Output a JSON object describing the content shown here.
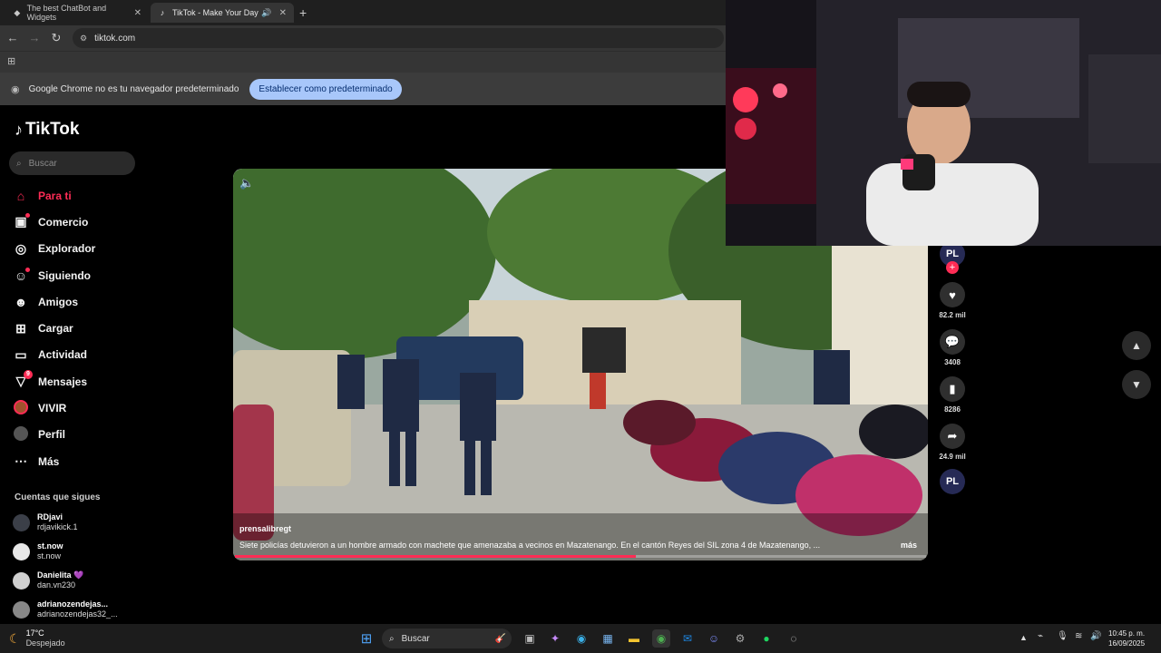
{
  "browser": {
    "tabs": [
      {
        "title": "The best ChatBot and Widgets",
        "icon": "chatbot-favicon-icon"
      },
      {
        "title": "TikTok - Make Your Day",
        "icon": "tiktok-favicon-icon"
      }
    ],
    "url": "tiktok.com",
    "infobar": {
      "message": "Google Chrome no es tu navegador predeterminado",
      "button": "Establecer como predeterminado"
    }
  },
  "tiktok": {
    "logo": "TikTok",
    "search_placeholder": "Buscar",
    "nav": [
      {
        "label": "Para ti",
        "icon": "home-icon",
        "glyph": "⌂"
      },
      {
        "label": "Comercio",
        "icon": "shop-icon",
        "glyph": "🛍"
      },
      {
        "label": "Explorador",
        "icon": "compass-icon",
        "glyph": "◎"
      },
      {
        "label": "Siguiendo",
        "icon": "following-icon",
        "glyph": "👤"
      },
      {
        "label": "Amigos",
        "icon": "friends-icon",
        "glyph": "👥"
      },
      {
        "label": "Cargar",
        "icon": "upload-icon",
        "glyph": "⊞"
      },
      {
        "label": "Actividad",
        "icon": "activity-icon",
        "glyph": "▭"
      },
      {
        "label": "Mensajes",
        "icon": "messages-icon",
        "glyph": "▽",
        "badge": "9"
      },
      {
        "label": "VIVIR",
        "icon": "live-icon",
        "glyph": "●"
      },
      {
        "label": "Perfil",
        "icon": "profile-icon",
        "glyph": "●"
      },
      {
        "label": "Más",
        "icon": "more-icon",
        "glyph": "⋯"
      }
    ],
    "following_title": "Cuentas que sigues",
    "following": [
      {
        "name": "RDjavi",
        "user": "rdjavikick.1"
      },
      {
        "name": "st.now",
        "user": "st.now"
      },
      {
        "name": "Danielita 💜",
        "user": "dan.vn230"
      },
      {
        "name": "adrianozendejas...",
        "user": "adrianozendejas32_..."
      }
    ],
    "video": {
      "author": "prensalibregt",
      "caption": "Siete policías detuvieron a un hombre armado con machete que amenazaba a vecinos en Mazatenango. En el cantón Reyes del SIL zona 4 de Mazatenango, ...",
      "more": "más",
      "progress": 0.58
    },
    "actions": {
      "avatar": "PL",
      "likes": "82.2 mil",
      "comments": "3408",
      "saves": "8286",
      "shares": "24.9 mil"
    }
  },
  "taskbar": {
    "temp": "17°C",
    "condition": "Despejado",
    "search": "Buscar",
    "time": "10:45 p. m.",
    "date": "16/09/2025"
  },
  "colors": {
    "accent": "#fe2c55",
    "infobar_button": "#a8c7fa"
  }
}
